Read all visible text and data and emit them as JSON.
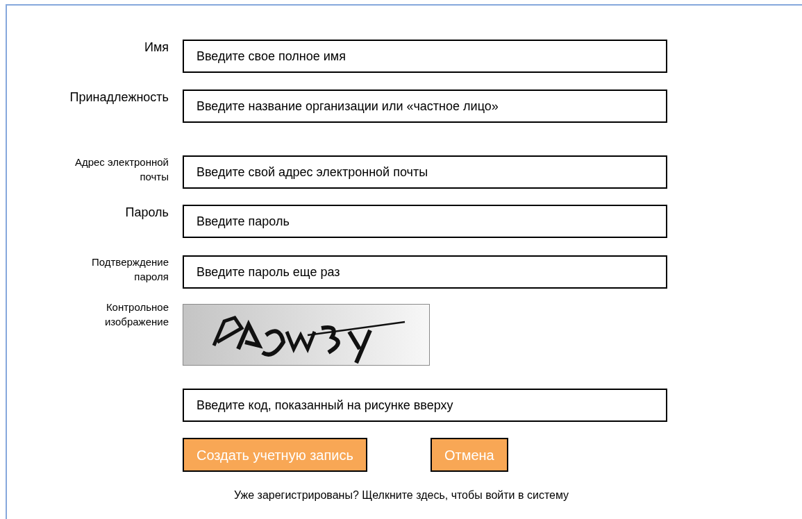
{
  "form": {
    "rows": [
      {
        "kind": "field",
        "label_lines": [
          "Имя"
        ],
        "placeholder": "Введите свое полное имя"
      },
      {
        "kind": "field",
        "label_lines": [
          "Принадлежность"
        ],
        "placeholder": "Введите название организации или «частное лицо»"
      },
      {
        "kind": "field",
        "label_lines": [
          "Адрес электронной",
          "почты"
        ],
        "placeholder": "Введите свой адрес электронной почты"
      },
      {
        "kind": "field",
        "label_lines": [
          "Пароль"
        ],
        "placeholder": "Введите пароль"
      },
      {
        "kind": "field",
        "label_lines": [
          "Подтверждение",
          "пароля"
        ],
        "placeholder": "Введите пароль еще раз"
      },
      {
        "kind": "captcha",
        "label_lines": [
          "Контрольное",
          "изображение"
        ]
      },
      {
        "kind": "field",
        "label_lines": [],
        "placeholder": "Введите код, показанный на рисунке вверху"
      }
    ],
    "buttons": [
      {
        "label": "Создать учетную запись"
      },
      {
        "label": "Отмена"
      }
    ],
    "footer": "Уже зарегистрированы? Щелкните здесь, чтобы войти в систему"
  }
}
